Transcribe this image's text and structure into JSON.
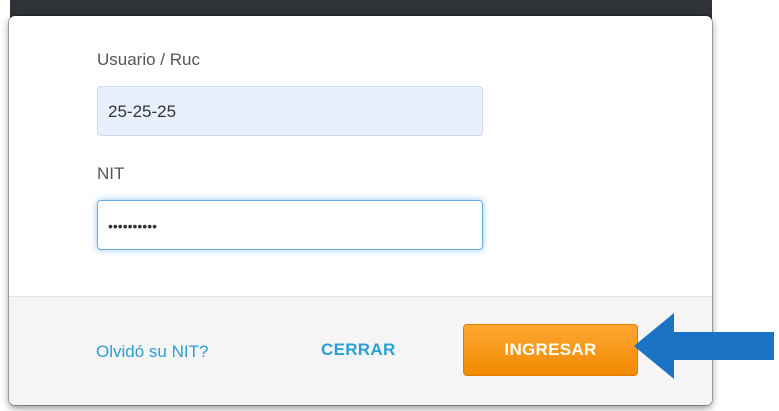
{
  "form": {
    "user_label": "Usuario / Ruc",
    "user_value": "25-25-25",
    "nit_label": "NIT",
    "nit_value": "••••••••••"
  },
  "footer": {
    "forgot_link": "Olvidó su NIT?",
    "close_button": "CERRAR",
    "submit_button": "INGRESAR"
  },
  "annotation": {
    "arrow_icon": "arrow-left-icon",
    "arrow_color": "#1a73c4"
  },
  "colors": {
    "accent": "#2a9fd6",
    "primary_button": "#f7931e"
  }
}
